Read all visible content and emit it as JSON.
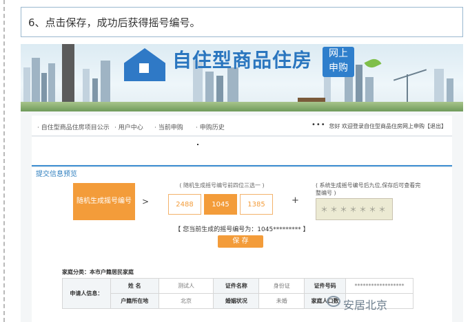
{
  "step_text": "6、点击保存，成功后获得摇号编号。",
  "banner": {
    "title": "自住型商品住房",
    "badge_line1": "网上",
    "badge_line2": "申购"
  },
  "nav": {
    "items": [
      "自住型商品住房项目公示",
      "用户中心",
      "当前申购",
      "申购历史"
    ],
    "dots": "•••",
    "welcome": "您好 欢迎登录自住型商品住房网上申购【退出】"
  },
  "section": {
    "title": "提交信息预览",
    "generate_button": "随机生成摇号编号",
    "arrow": ">",
    "candidates_label": "( 随机生成摇号编号前四位三选一 )",
    "candidates": [
      "2488",
      "1045",
      "1385"
    ],
    "selected_index": 1,
    "plus": "+",
    "system_note": "( 系统生成摇号编号后九位,保存后可查看完整编号 )",
    "masked_suffix": "＊＊＊＊＊＊＊",
    "current_number": "【 您当前生成的摇号编号为：1045********* 】",
    "save_button": "保  存",
    "family_category": "家庭分类：本市户籍居民家庭"
  },
  "table": {
    "applicant_label": "申请人信息：",
    "row1": {
      "name_label": "姓  名",
      "name_value": "测试人",
      "id_type_label": "证件名称",
      "id_type_value": "身份证",
      "id_no_label": "证件号码",
      "id_no_value": "******************"
    },
    "row2": {
      "hukou_label": "户籍所在地",
      "hukou_value": "北京",
      "marital_label": "婚姻状况",
      "marital_value": "未婚",
      "household_label": "家庭人口数",
      "household_value": ""
    }
  },
  "watermark": "安居北京",
  "colors": {
    "accent_orange": "#f39c3a",
    "brand_blue": "#2a76bf"
  }
}
